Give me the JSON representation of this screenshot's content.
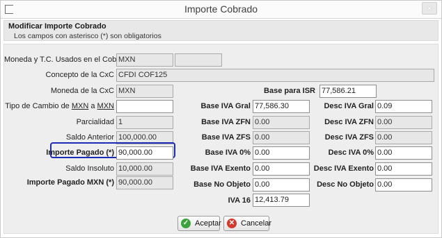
{
  "window": {
    "title": "Importe Cobrado",
    "close_glyph": "×"
  },
  "header": {
    "title": "Modificar Importe Cobrado",
    "subtitle": "Los campos con asterisco (*) son obligatorios"
  },
  "left": {
    "moneda_tc_label": "Moneda y T.C. Usados en el Cobro",
    "moneda_tc_value": "MXN",
    "moneda_tc_value2": "",
    "concepto_label": "Concepto de la CxC",
    "concepto_value": "CFDI COF125",
    "moneda_cxc_label": "Moneda de la CxC",
    "moneda_cxc_value": "MXN",
    "tipo_cambio_label_prefix": "Tipo de Cambio de ",
    "tipo_cambio_from": "MXN",
    "tipo_cambio_mid": " a ",
    "tipo_cambio_to": "MXN",
    "tipo_cambio_value": "",
    "parcialidad_label": "Parcialidad",
    "parcialidad_value": "1",
    "saldo_anterior_label": "Saldo Anterior",
    "saldo_anterior_value": "100,000.00",
    "importe_pagado_label": "Importe Pagado (*)",
    "importe_pagado_value": "90,000.00",
    "saldo_insoluto_label": "Saldo Insoluto",
    "saldo_insoluto_value": "10,000.00",
    "importe_pagado_mxn_label": "Importe Pagado MXN (*)",
    "importe_pagado_mxn_value": "90,000.00"
  },
  "middle": {
    "base_isr_label": "Base para ISR",
    "base_isr_value": "77,586.21",
    "base_iva_gral_label": "Base IVA Gral",
    "base_iva_gral_value": "77,586.30",
    "base_iva_zfn_label": "Base IVA ZFN",
    "base_iva_zfn_value": "0.00",
    "base_iva_zfs_label": "Base IVA ZFS",
    "base_iva_zfs_value": "0.00",
    "base_iva_0_label": "Base IVA 0%",
    "base_iva_0_value": "0.00",
    "base_iva_exento_label": "Base IVA Exento",
    "base_iva_exento_value": "0.00",
    "base_no_objeto_label": "Base No Objeto",
    "base_no_objeto_value": "0.00",
    "iva16_label": "IVA 16",
    "iva16_value": "12,413.79"
  },
  "right": {
    "desc_iva_gral_label": "Desc IVA Gral",
    "desc_iva_gral_value": "0.09",
    "desc_iva_zfn_label": "Desc IVA ZFN",
    "desc_iva_zfn_value": "0.00",
    "desc_iva_zfs_label": "Desc IVA ZFS",
    "desc_iva_zfs_value": "0.00",
    "desc_iva_0_label": "Desc IVA 0%",
    "desc_iva_0_value": "0.00",
    "desc_iva_exento_label": "Desc IVA Exento",
    "desc_iva_exento_value": "0.00",
    "desc_no_objeto_label": "Desc No Objeto",
    "desc_no_objeto_value": "0.00"
  },
  "buttons": {
    "accept_label": "Aceptar",
    "accept_icon": "check-icon",
    "accept_color": "#3aa43a",
    "cancel_label": "Cancelar",
    "cancel_icon": "close-icon",
    "cancel_color": "#d33a2c"
  },
  "highlight_color": "#1b2bb8"
}
